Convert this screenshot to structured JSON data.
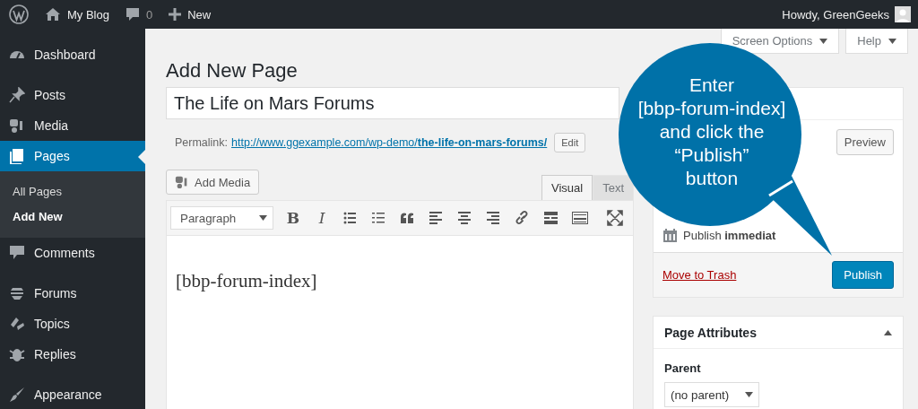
{
  "admin_bar": {
    "site": "My Blog",
    "comments_count": "0",
    "new_label": "New",
    "greeting": "Howdy, GreenGeeks"
  },
  "sidebar": {
    "items": [
      {
        "label": "Dashboard",
        "selected": false
      },
      {
        "label": "Posts",
        "selected": false
      },
      {
        "label": "Media",
        "selected": false
      },
      {
        "label": "Pages",
        "selected": true,
        "children": [
          {
            "label": "All Pages",
            "selected": false
          },
          {
            "label": "Add New",
            "selected": true
          }
        ]
      },
      {
        "label": "Comments",
        "selected": false
      },
      {
        "label": "Forums",
        "selected": false
      },
      {
        "label": "Topics",
        "selected": false
      },
      {
        "label": "Replies",
        "selected": false
      },
      {
        "label": "Appearance",
        "selected": false
      }
    ]
  },
  "screen_meta": [
    "Screen Options",
    "Help"
  ],
  "page_title": "Add New Page",
  "title_field": {
    "value": "The Life on Mars Forums"
  },
  "permalink": {
    "label": "Permalink:",
    "url_base": "http://www.ggexample.com/wp-demo/",
    "slug": "the-life-on-mars-forums/",
    "edit": "Edit"
  },
  "add_media": "Add Media",
  "editor_tabs": [
    {
      "label": "Visual",
      "selected": true
    },
    {
      "label": "Text",
      "selected": false
    }
  ],
  "format_select": "Paragraph",
  "toolbar_glyphs": [
    "B",
    "I"
  ],
  "content": "[bbp-forum-index]",
  "publish_box": {
    "preview": "Preview",
    "schedule": "Publish **immediat**",
    "trash": "Move to Trash",
    "publish": "Publish"
  },
  "page_attributes": {
    "title": "Page Attributes",
    "parent_label": "Parent",
    "parent_value": "(no parent)"
  },
  "callout": {
    "lines": [
      "Enter",
      "[bbp-forum-index]",
      "and click the",
      "“Publish”",
      "button"
    ]
  }
}
